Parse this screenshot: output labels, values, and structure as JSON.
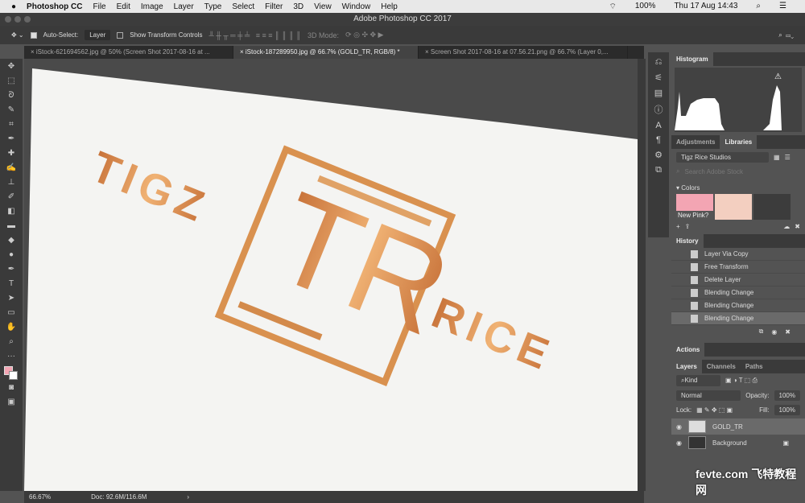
{
  "menubar": {
    "apple": "",
    "app": "Photoshop CC",
    "items": [
      "File",
      "Edit",
      "Image",
      "Layer",
      "Type",
      "Select",
      "Filter",
      "3D",
      "View",
      "Window",
      "Help"
    ],
    "battery": "100%",
    "datetime": "Thu 17 Aug  14:43"
  },
  "window": {
    "title": "Adobe Photoshop CC 2017"
  },
  "options": {
    "auto_select_label": "Auto-Select:",
    "auto_select_value": "Layer",
    "show_transform": "Show Transform Controls",
    "mode_3d": "3D Mode:"
  },
  "tabs": [
    {
      "label": "iStock-621694562.jpg @ 50% (Screen Shot 2017-08-16 at ..."
    },
    {
      "label": "iStock-187289950.jpg @ 66.7% (GOLD_TR, RGB/8) *"
    },
    {
      "label": "Screen Shot 2017-08-16 at 07.56.21.png @ 66.7% (Layer 0,..."
    }
  ],
  "artwork": {
    "word1": "TIGZ",
    "mono": "TR",
    "word2": "RICE"
  },
  "status": {
    "zoom": "66.67%",
    "doc": "Doc: 92.6M/116.6M"
  },
  "panels": {
    "histogram": "Histogram",
    "adj_tab": "Adjustments",
    "lib_tab": "Libraries",
    "library": "Tigz Rice Studios",
    "search_placeholder": "Search Adobe Stock",
    "colors_label": "▾ Colors",
    "swatches": [
      {
        "label": "New Pink?",
        "color": "#f3a5b3"
      },
      {
        "label": "",
        "color": "#f3cfc0"
      },
      {
        "label": "",
        "color": "#3c3c3c"
      }
    ],
    "history_title": "History",
    "history": [
      "Layer Via Copy",
      "Free Transform",
      "Delete Layer",
      "Blending Change",
      "Blending Change",
      "Blending Change"
    ],
    "actions": "Actions",
    "layers_tab": "Layers",
    "channels_tab": "Channels",
    "paths_tab": "Paths",
    "kind": "Kind",
    "blend": "Normal",
    "opacity_label": "Opacity:",
    "opacity": "100%",
    "lock_label": "Lock:",
    "fill_label": "Fill:",
    "fill": "100%",
    "layers": [
      {
        "name": "GOLD_TR"
      },
      {
        "name": "Background"
      }
    ]
  },
  "watermark": "fevte.com 飞特教程网"
}
